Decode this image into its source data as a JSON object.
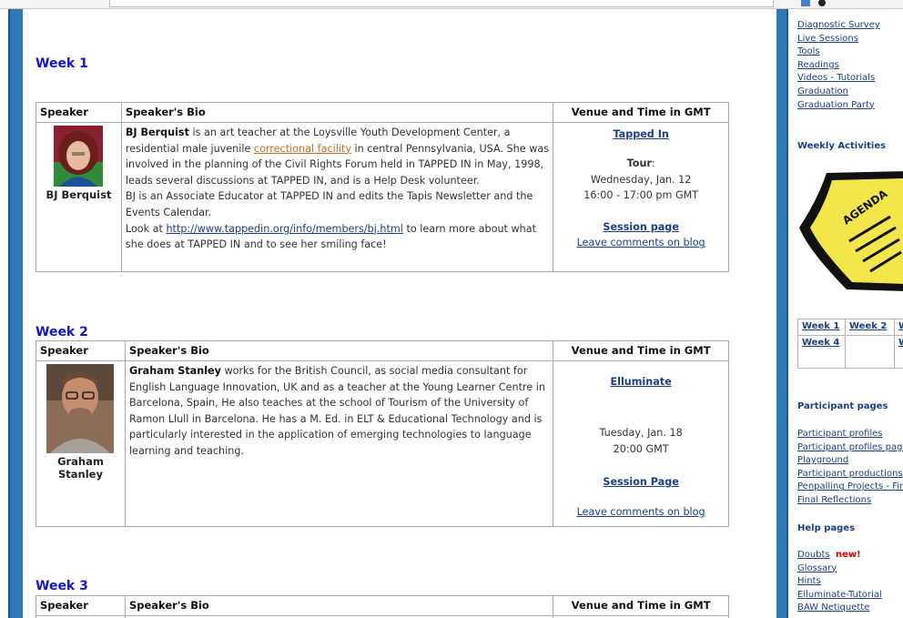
{
  "weeks": [
    {
      "title": "Week 1",
      "headers": {
        "speaker": "Speaker",
        "bio": "Speaker's Bio",
        "venue": "Venue and Time in GMT"
      },
      "speaker_name": "BJ Berquist",
      "bio": {
        "name": "BJ Berquist",
        "text1": " is an art teacher at the Loysville Youth Development Center, a residential male juvenile ",
        "link1": "correctional facility",
        "text2": " in central Pennsylvania, USA. She was involved in the planning of the Civil Rights Forum held in TAPPED IN in May, 1998, leads several discussions at TAPPED IN, and is a Help Desk volunteer.",
        "para2": "BJ is an Associate Educator at TAPPED IN and edits the Tapis Newsletter and the Events Calendar.",
        "para3_pre": "Look at ",
        "link2": "http://www.tappedin.org/info/members/bj.html",
        "para3_post": " to learn more about what she does at TAPPED IN and to see her smiling face!"
      },
      "venue": {
        "platform": "Tapped In",
        "label": "Tour",
        "label_suffix": ":",
        "date": "Wednesday, Jan. 12",
        "time": "16:00 - 17:00 pm GMT",
        "session": "Session page",
        "comments": "Leave comments on blog"
      }
    },
    {
      "title": "Week 2",
      "headers": {
        "speaker": "Speaker",
        "bio": "Speaker's Bio",
        "venue": "Venue and Time in GMT"
      },
      "speaker_name": "Graham Stanley",
      "bio": {
        "name": "Graham Stanley",
        "text1": " works for the British Council, as social media consultant for English Language Innovation, UK and as a teacher at the Young Learner Centre in Barcelona, Spain, He also teaches at the school of Tourism of the University of Ramon Llull in Barcelona. He has a M. Ed. in ELT & Educational Technology and is particularly interested in the application of emerging technologies to language learning and teaching."
      },
      "venue": {
        "platform": "Elluminate",
        "date": "Tuesday, Jan. 18",
        "time": "20:00 GMT",
        "session": "Session Page",
        "comments": "Leave comments on blog"
      }
    },
    {
      "title": "Week 3",
      "headers": {
        "speaker": "Speaker",
        "bio": "Speaker's Bio",
        "venue": "Venue and Time in GMT"
      }
    }
  ],
  "sidebar": {
    "top_links": [
      "Diagnostic Survey",
      "Live Sessions",
      "Tools",
      "Readings",
      "Videos - Tutorials",
      "Graduation",
      "Graduation Party"
    ],
    "weekly_heading": "Weekly Activities",
    "agenda_text": "AGENDA",
    "week_nav": [
      "Week 1",
      "Week 2",
      "W",
      "Week 4",
      "",
      "W"
    ],
    "participant_heading": "Participant pages",
    "participant_links": [
      "Participant profiles",
      "Participant profiles page",
      "Playground",
      "Participant productions",
      "Penpalling Projects - Find",
      "Final Reflections"
    ],
    "help_heading": "Help pages",
    "help_first": "Doubts",
    "help_new": "new!",
    "help_links": [
      "Glossary",
      "Hints",
      "Elluminate-Tutorial",
      "BAW Netiquette"
    ]
  },
  "colors": {
    "side_bar": "#2d79ba",
    "week_heading": "#1414d4",
    "link": "#1a3e8c",
    "orange_link": "#d2691e",
    "new_badge": "#e00000"
  }
}
